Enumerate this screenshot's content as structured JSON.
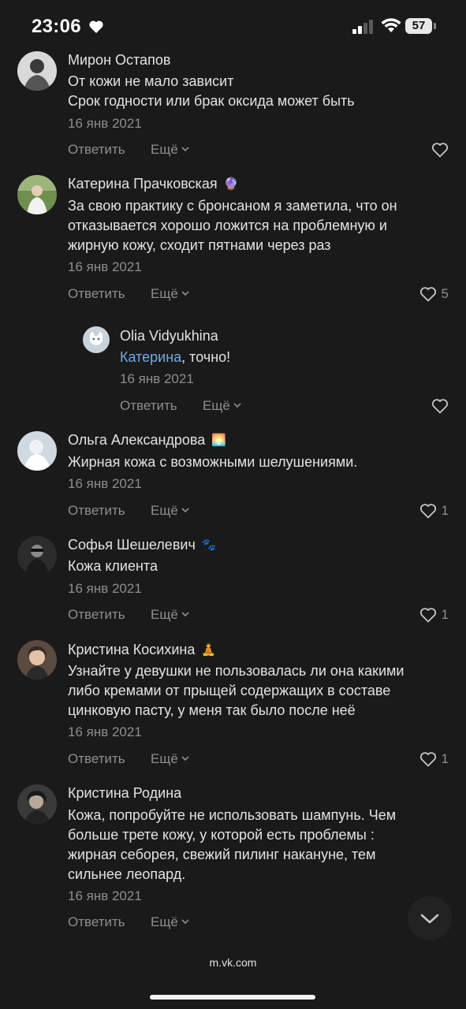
{
  "status_bar": {
    "time": "23:06",
    "battery": "57"
  },
  "comments": [
    {
      "author": "Мирон Остапов",
      "emoji": "",
      "lines": [
        "От кожи не мало зависит",
        "Срок годности или брак оксида может быть"
      ],
      "date": "16 янв 2021",
      "reply_label": "Ответить",
      "more_label": "Ещё",
      "likes": ""
    },
    {
      "author": "Катерина Прачковская",
      "emoji": "🔮",
      "lines": [
        "За свою практику с бронсаном я заметила, что он",
        "отказывается хорошо ложится на проблемную и",
        "жирную кожу, сходит пятнами через раз"
      ],
      "date": "16 янв 2021",
      "reply_label": "Ответить",
      "more_label": "Ещё",
      "likes": "5"
    },
    {
      "author": "Olia Vidyukhina",
      "emoji": "",
      "mention": "Катерина",
      "text_after_mention": ", точно!",
      "date": "16 янв 2021",
      "reply_label": "Ответить",
      "more_label": "Ещё",
      "likes": ""
    },
    {
      "author": "Ольга Александрова",
      "emoji": "🌅",
      "lines": [
        "Жирная кожа с возможными шелушениями."
      ],
      "date": "16 янв 2021",
      "reply_label": "Ответить",
      "more_label": "Ещё",
      "likes": "1"
    },
    {
      "author": "Софья Шешелевич",
      "emoji": "🐾",
      "lines": [
        "Кожа клиента"
      ],
      "date": "16 янв 2021",
      "reply_label": "Ответить",
      "more_label": "Ещё",
      "likes": "1"
    },
    {
      "author": "Кристина Косихина",
      "emoji": "🧘",
      "lines": [
        "Узнайте у девушки не пользовалась ли она какими",
        "либо кремами от прыщей содержащих в составе",
        "цинковую пасту, у меня так было после неё"
      ],
      "date": "16 янв 2021",
      "reply_label": "Ответить",
      "more_label": "Ещё",
      "likes": "1"
    },
    {
      "author": "Кристина Родина",
      "emoji": "",
      "lines": [
        "Кожа, попробуйте не использовать шампунь. Чем",
        "больше трете кожу, у которой есть проблемы :",
        "жирная себорея, свежий пилинг накануне, тем",
        "сильнее леопард."
      ],
      "date": "16 янв 2021",
      "reply_label": "Ответить",
      "more_label": "Ещё",
      "likes": ""
    }
  ],
  "footer": {
    "url": "m.vk.com"
  },
  "colors": {
    "background": "#1a1a1a",
    "text": "#e1e3e6",
    "secondary": "#8c8e91",
    "link": "#71aaeb"
  }
}
